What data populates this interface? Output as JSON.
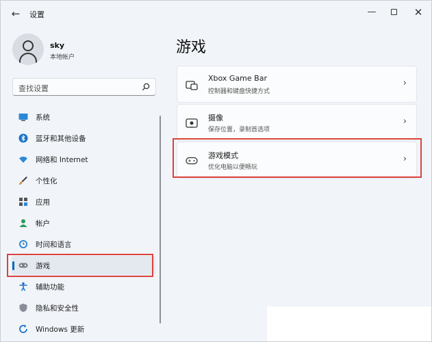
{
  "window": {
    "back_glyph": "←",
    "title": "设置",
    "min_glyph": "—",
    "close_glyph": "✕"
  },
  "user": {
    "name": "sky",
    "account_type": "本地帐户"
  },
  "search": {
    "placeholder": "查找设置"
  },
  "sidebar": {
    "items": [
      {
        "label": "系统",
        "icon": "monitor-icon"
      },
      {
        "label": "蓝牙和其他设备",
        "icon": "bluetooth-icon"
      },
      {
        "label": "网络和 Internet",
        "icon": "wifi-icon"
      },
      {
        "label": "个性化",
        "icon": "brush-icon"
      },
      {
        "label": "应用",
        "icon": "apps-icon"
      },
      {
        "label": "帐户",
        "icon": "person-icon"
      },
      {
        "label": "时间和语言",
        "icon": "globe-clock-icon"
      },
      {
        "label": "游戏",
        "icon": "gamepad-icon",
        "selected": true
      },
      {
        "label": "辅助功能",
        "icon": "accessibility-icon"
      },
      {
        "label": "隐私和安全性",
        "icon": "shield-icon"
      },
      {
        "label": "Windows 更新",
        "icon": "update-icon"
      }
    ]
  },
  "main": {
    "title": "游戏",
    "cards": [
      {
        "title": "Xbox Game Bar",
        "subtitle": "控制器和键盘快捷方式",
        "icon": "game-bar-icon",
        "chevron": "›"
      },
      {
        "title": "摄像",
        "subtitle": "保存位置，录制首选项",
        "icon": "capture-icon",
        "chevron": "›"
      },
      {
        "title": "游戏模式",
        "subtitle": "优化电脑以便畅玩",
        "icon": "game-mode-icon",
        "chevron": "›"
      }
    ]
  },
  "colors": {
    "accent": "#0067c0",
    "highlight": "#d9433c"
  }
}
